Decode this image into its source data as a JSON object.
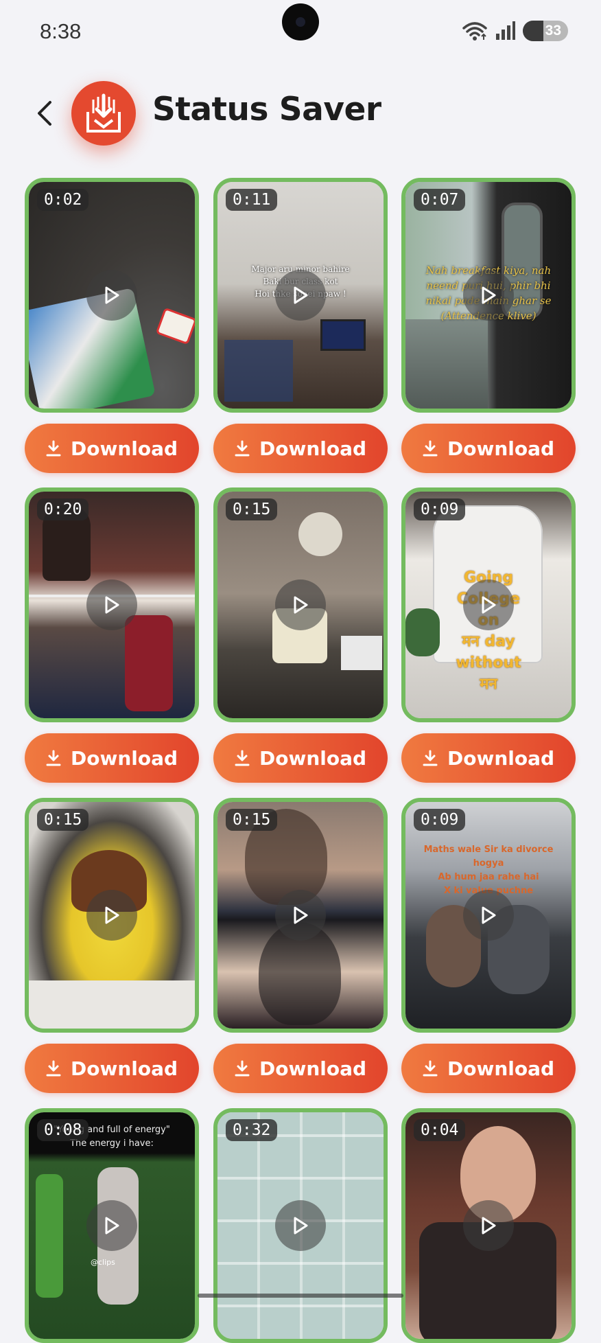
{
  "status_bar": {
    "time": "8:38",
    "battery": "33"
  },
  "header": {
    "title": "Status Saver"
  },
  "colors": {
    "accent": "#e4492f",
    "border": "#74bb5f",
    "button_from": "#f07a40",
    "button_to": "#e2452c"
  },
  "download_label": "Download",
  "videos": [
    {
      "duration": "0:02",
      "overlay": []
    },
    {
      "duration": "0:11",
      "overlay": [
        "Major aru minor bahire",
        "Baki bur class kot",
        "Hoi thke sonei npaw !"
      ]
    },
    {
      "duration": "0:07",
      "overlay": [
        "Nah breakfast kiya, nah",
        "neend puri hui, phir bhi",
        "nikal pade main ghar se",
        "(Attendence klive)"
      ]
    },
    {
      "duration": "0:20",
      "overlay": []
    },
    {
      "duration": "0:15",
      "overlay": []
    },
    {
      "duration": "0:09",
      "overlay": [
        "Going",
        "College",
        "on",
        "मन day",
        "without",
        "मन"
      ]
    },
    {
      "duration": "0:15",
      "overlay": []
    },
    {
      "duration": "0:15",
      "overlay": []
    },
    {
      "duration": "0:09",
      "overlay": [
        "Maths wale Sir ka divorce hogya",
        "Ab hum jaa rahe hai",
        "X ki value puchne"
      ]
    },
    {
      "duration": "0:08",
      "overlay": [
        "\"Young and full of energy\"",
        "The energy i have:",
        "@clips"
      ]
    },
    {
      "duration": "0:32",
      "overlay": []
    },
    {
      "duration": "0:04",
      "overlay": []
    }
  ]
}
